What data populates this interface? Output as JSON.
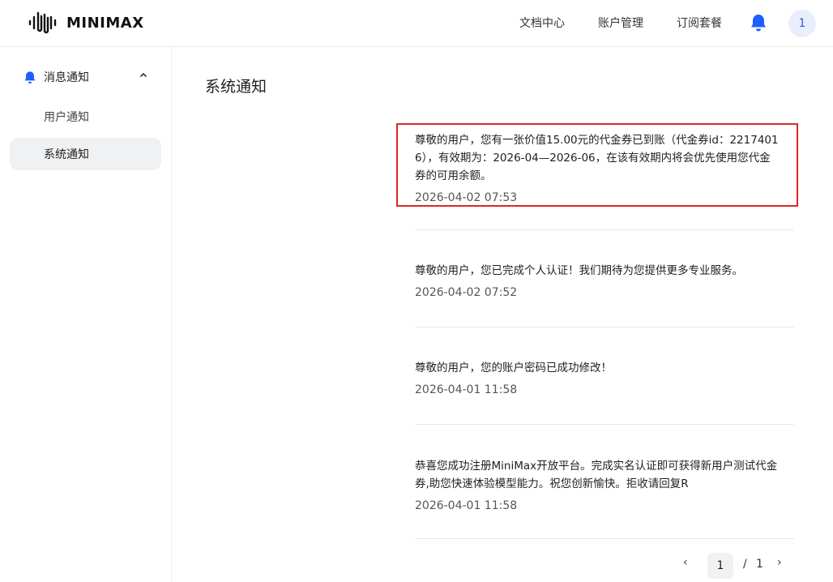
{
  "header": {
    "brand": "MINIMAX",
    "nav": [
      "文档中心",
      "账户管理",
      "订阅套餐"
    ],
    "avatar_text": "1"
  },
  "sidebar": {
    "group_label": "消息通知",
    "items": [
      {
        "label": "用户通知",
        "active": false
      },
      {
        "label": "系统通知",
        "active": true
      }
    ]
  },
  "main": {
    "title": "系统通知",
    "notices": [
      {
        "lines": [
          "尊敬的用户，您有一张价值15.00元的代金券已到账（代金券id：2217401",
          "6），有效期为：2026-04—2026-06，在该有效期内将会优先使用您代金",
          "券的可用余额。"
        ],
        "time": "2026-04-02 07:53",
        "highlighted": true
      },
      {
        "lines": [
          "尊敬的用户，您已完成个人认证！我们期待为您提供更多专业服务。"
        ],
        "time": "2026-04-02 07:52",
        "highlighted": false
      },
      {
        "lines": [
          "尊敬的用户，您的账户密码已成功修改！"
        ],
        "time": "2026-04-01 11:58",
        "highlighted": false
      },
      {
        "lines": [
          "恭喜您成功注册MiniMax开放平台。完成实名认证即可获得新用户测试代金",
          "券,助您快速体验模型能力。祝您创新愉快。拒收请回复R"
        ],
        "time": "2026-04-01 11:58",
        "highlighted": false
      }
    ]
  },
  "pagination": {
    "prev": "‹",
    "current": "1",
    "separator": "/",
    "total": "1",
    "next": "›"
  },
  "colors": {
    "accent": "#1f5eff",
    "highlight_border": "#d9262c",
    "active_bg": "#f0f1f3"
  }
}
